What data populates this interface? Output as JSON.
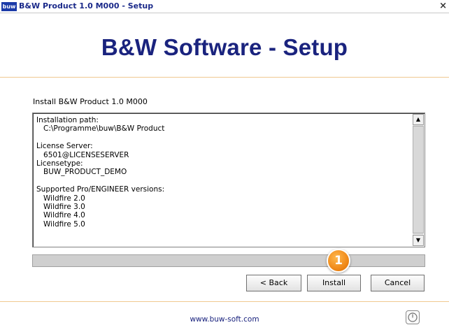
{
  "window": {
    "icon_text": "buw",
    "title": "B&W Product 1.0 M000 - Setup",
    "close_glyph": "×"
  },
  "header": {
    "headline": "B&W Software - Setup"
  },
  "main": {
    "install_label": "Install B&W Product 1.0 M000",
    "info_lines": [
      "Installation path:",
      "   C:\\Programme\\buw\\B&W Product",
      "",
      "License Server:",
      "   6501@LICENSESERVER",
      "Licensetype:",
      "   BUW_PRODUCT_DEMO",
      "",
      "Supported Pro/ENGINEER versions:",
      "   Wildfire 2.0",
      "   Wildfire 3.0",
      "   Wildfire 4.0",
      "   Wildfire 5.0"
    ],
    "scroll_up_glyph": "▲",
    "scroll_down_glyph": "▼",
    "progress_fraction": 0.0,
    "callout_number": "1"
  },
  "buttons": {
    "back": "< Back",
    "install": "Install",
    "cancel": "Cancel"
  },
  "footer": {
    "link": "www.buw-soft.com",
    "icon": "power-icon"
  },
  "colors": {
    "brand": "#1a237e",
    "accent_line": "#f0c890",
    "callout": "#f08a1a"
  }
}
